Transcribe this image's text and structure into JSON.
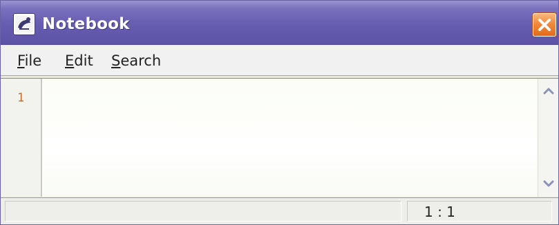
{
  "window": {
    "title": "Notebook",
    "icon": "notebook-app-icon",
    "close_icon": "close-icon"
  },
  "menu": {
    "items": [
      {
        "mnemonic": "F",
        "rest": "ile"
      },
      {
        "mnemonic": "E",
        "rest": "dit"
      },
      {
        "mnemonic": "S",
        "rest": "earch"
      }
    ]
  },
  "editor": {
    "line_numbers": [
      "1"
    ],
    "content": "",
    "scroll_up_icon": "chevron-up-icon",
    "scroll_down_icon": "chevron-down-icon"
  },
  "status": {
    "message": "",
    "cursor_position": "1 : 1"
  },
  "colors": {
    "titlebar": "#665cb0",
    "close_button": "#f08a3c",
    "line_number": "#c9692b"
  }
}
